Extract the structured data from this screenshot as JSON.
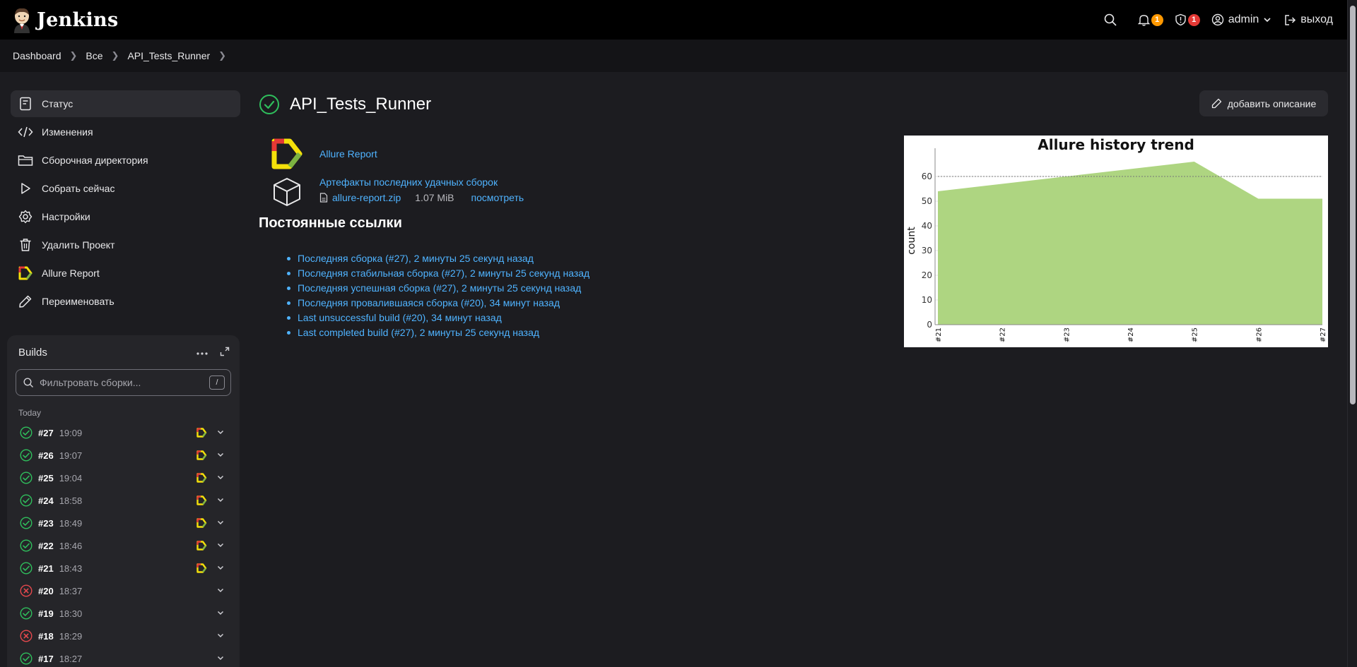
{
  "header": {
    "app_title": "Jenkins",
    "notifications_count": "1",
    "security_count": "1",
    "user": "admin",
    "logout": "выход"
  },
  "breadcrumb": [
    "Dashboard",
    "Все",
    "API_Tests_Runner"
  ],
  "sidebar": {
    "items": [
      {
        "label": "Статус",
        "icon": "status-icon",
        "active": true
      },
      {
        "label": "Изменения",
        "icon": "code-icon"
      },
      {
        "label": "Сборочная директория",
        "icon": "folder-icon"
      },
      {
        "label": "Собрать сейчас",
        "icon": "play-icon"
      },
      {
        "label": "Настройки",
        "icon": "gear-icon"
      },
      {
        "label": "Удалить Проект",
        "icon": "trash-icon"
      },
      {
        "label": "Allure Report",
        "icon": "allure-icon"
      },
      {
        "label": "Переименовать",
        "icon": "pencil-icon"
      }
    ]
  },
  "builds": {
    "title": "Builds",
    "filter_placeholder": "Фильтровать сборки...",
    "filter_shortcut": "/",
    "section": "Today",
    "items": [
      {
        "num": "#27",
        "time": "19:09",
        "status": "success",
        "allure": true
      },
      {
        "num": "#26",
        "time": "19:07",
        "status": "success",
        "allure": true
      },
      {
        "num": "#25",
        "time": "19:04",
        "status": "success",
        "allure": true
      },
      {
        "num": "#24",
        "time": "18:58",
        "status": "success",
        "allure": true
      },
      {
        "num": "#23",
        "time": "18:49",
        "status": "success",
        "allure": true
      },
      {
        "num": "#22",
        "time": "18:46",
        "status": "success",
        "allure": true
      },
      {
        "num": "#21",
        "time": "18:43",
        "status": "success",
        "allure": true
      },
      {
        "num": "#20",
        "time": "18:37",
        "status": "failed",
        "allure": false
      },
      {
        "num": "#19",
        "time": "18:30",
        "status": "success",
        "allure": false
      },
      {
        "num": "#18",
        "time": "18:29",
        "status": "failed",
        "allure": false
      },
      {
        "num": "#17",
        "time": "18:27",
        "status": "success",
        "allure": false
      }
    ]
  },
  "main": {
    "title": "API_Tests_Runner",
    "add_description": "добавить описание",
    "allure_link": "Allure Report",
    "artifacts_title": "Артефакты последних удачных сборок",
    "artifact_file": "allure-report.zip",
    "artifact_size": "1.07 MiB",
    "artifact_view": "посмотреть",
    "permalinks_title": "Постоянные ссылки",
    "permalinks": [
      "Последняя сборка (#27), 2 минуты 25 секунд назад",
      "Последняя стабильная сборка (#27), 2 минуты 25 секунд назад",
      "Последняя успешная сборка (#27), 2 минуты 25 секунд назад",
      "Последняя провалившаяся сборка (#20), 34 минут назад",
      "Last unsuccessful build (#20), 34 минут назад",
      "Last completed build (#27), 2 минуты 25 секунд назад"
    ]
  },
  "colors": {
    "link": "#4fb3ff",
    "success": "#2fbe5c",
    "failed": "#e5484d",
    "chart_fill": "#aed581"
  },
  "chart_data": {
    "type": "area",
    "title": "Allure history trend",
    "ylabel": "count",
    "xlabel": "",
    "categories": [
      "#21",
      "#22",
      "#23",
      "#24",
      "#25",
      "#26",
      "#27"
    ],
    "series": [
      {
        "values": [
          54,
          57,
          60,
          63,
          66,
          51,
          51
        ]
      }
    ],
    "ylim": [
      0,
      68
    ],
    "yticks": [
      0,
      10,
      20,
      30,
      40,
      50,
      60
    ],
    "reference_line": 60,
    "grid": true
  }
}
